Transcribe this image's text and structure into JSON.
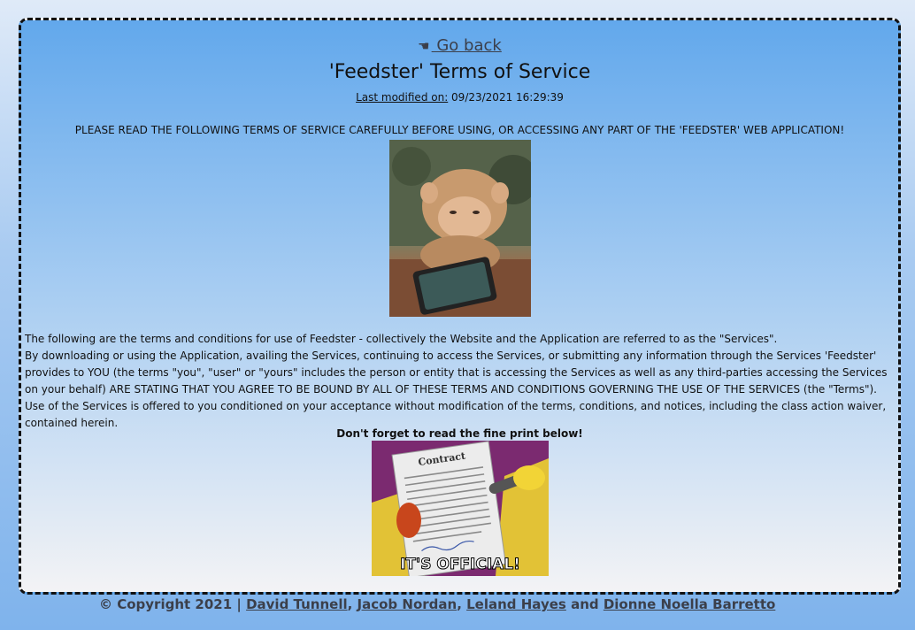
{
  "nav": {
    "back_label": " Go back",
    "back_icon": "pointing-hand-icon"
  },
  "header": {
    "title": "'Feedster' Terms of Service",
    "modified_label": "Last modified on:",
    "modified_value": " 09/23/2021 16:29:39"
  },
  "warning": "PLEASE READ THE FOLLOWING TERMS OF SERVICE CAREFULLY BEFORE USING, OR ACCESSING ANY PART OF THE 'FEEDSTER' WEB APPLICATION!",
  "terms": {
    "line1": "The following are the terms and conditions for use of Feedster - collectively the Website and the Application are referred to as the \"Services\".",
    "paragraph": "By downloading or using the Application, availing the Services, continuing to access the Services, or submitting any information through the Services 'Feedster' provides to YOU (the terms \"you\", \"user\" or \"yours\" includes the person or entity that is accessing the Services as well as any third-parties accessing the Services on your behalf) ARE STATING THAT YOU AGREE TO BE BOUND BY ALL OF THESE TERMS AND CONDITIONS GOVERNING THE USE OF THE SERVICES (the \"Terms\"). Use of the Services is offered to you conditioned on your acceptance without modification of the terms, conditions, and notices, including the class action waiver, contained herein."
  },
  "fineprint": "Don't forget to read the fine print below!",
  "contract_image": {
    "heading": "Contract",
    "caption": "IT'S OFFICIAL!"
  },
  "footer": {
    "copyright": "© Copyright 2021 | ",
    "authors": [
      "David Tunnell",
      "Jacob Nordan",
      "Leland Hayes",
      "Dionne Noella Barretto"
    ],
    "sep1": ", ",
    "sep2": ", ",
    "sep3": " and "
  }
}
